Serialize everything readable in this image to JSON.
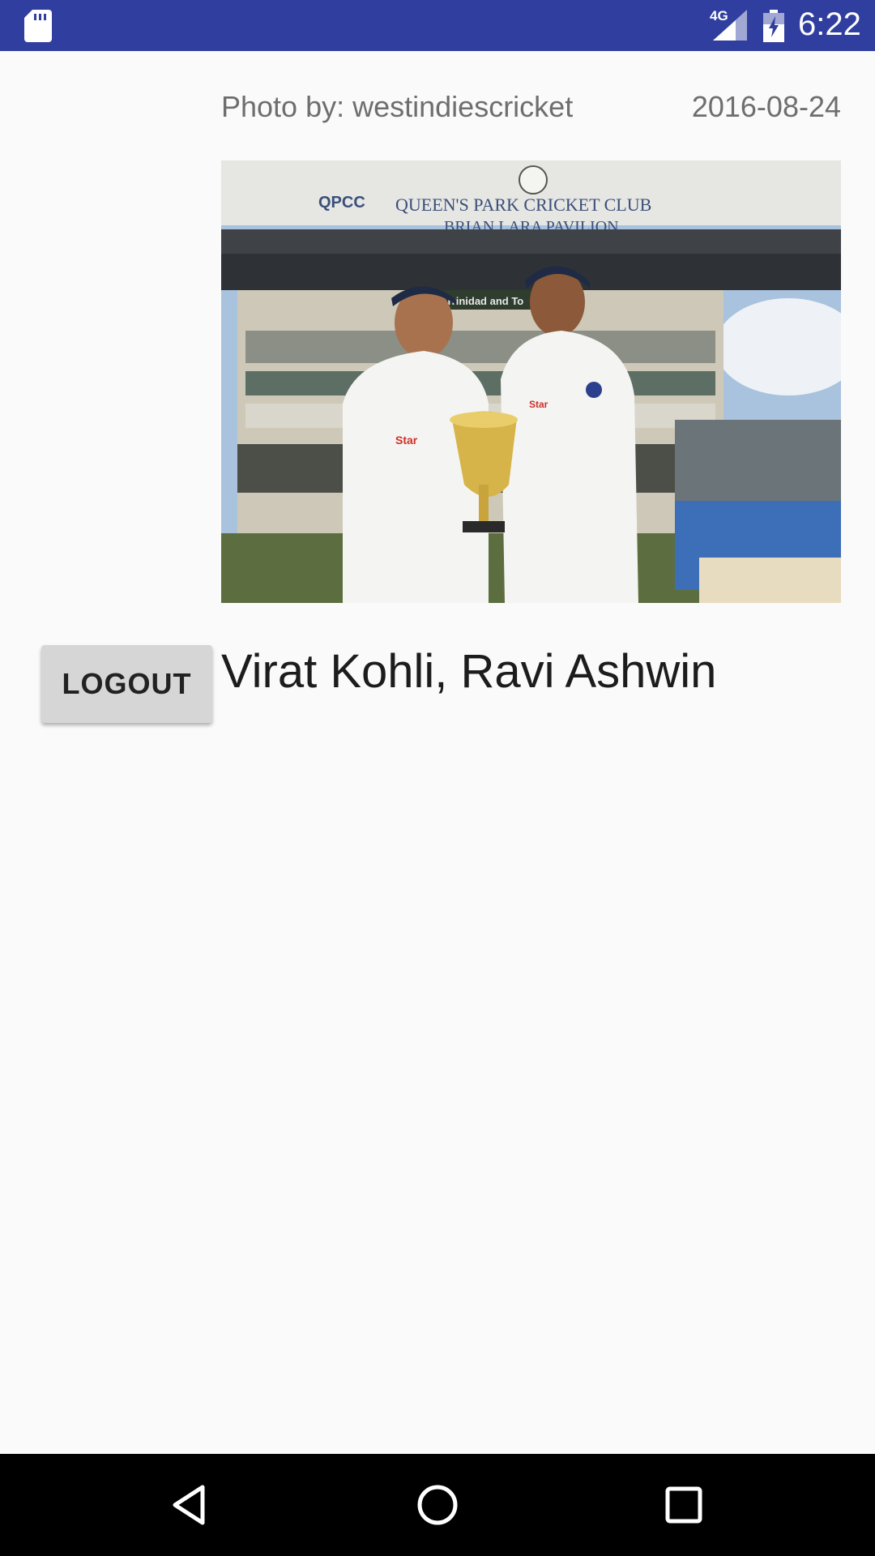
{
  "status_bar": {
    "network": "4G",
    "time": "6:22",
    "icons": [
      "sd-card-icon",
      "signal-icon",
      "battery-charging-icon"
    ]
  },
  "photo": {
    "credit": "Photo by: westindiescricket",
    "date": "2016-08-24",
    "stand_sign_line1": "QUEEN'S PARK CRICKET CLUB",
    "stand_sign_line2": "BRIAN LARA PAVILION",
    "stand_logo": "QPCC",
    "sponsor_banner": "BP Trinidad and To",
    "jersey_text": "Star"
  },
  "caption": "Virat Kohli, Ravi Ashwin",
  "logout_label": "LOGOUT",
  "nav": {
    "icons": [
      "back-icon",
      "home-icon",
      "recents-icon"
    ]
  },
  "colors": {
    "status_bar": "#303f9f",
    "background": "#fafafa",
    "button": "#d6d6d6"
  }
}
